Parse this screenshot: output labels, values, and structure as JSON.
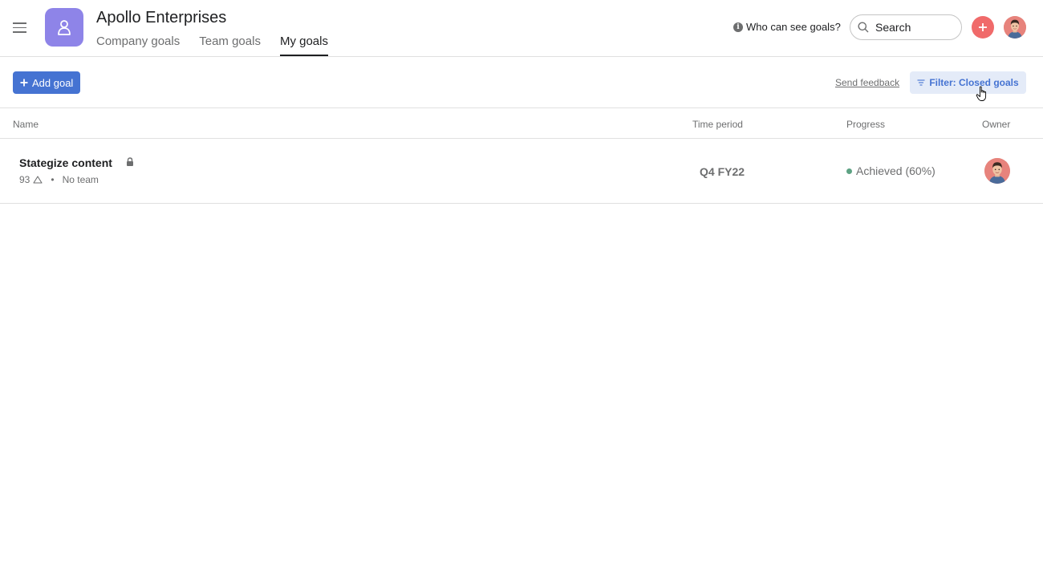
{
  "header": {
    "org_name": "Apollo Enterprises",
    "tabs": [
      {
        "label": "Company goals",
        "active": false
      },
      {
        "label": "Team goals",
        "active": false
      },
      {
        "label": "My goals",
        "active": true
      }
    ],
    "visibility_link": "Who can see goals?",
    "search_placeholder": "Search",
    "accent_color": "#f06a6a",
    "logo_color": "#8e84e8"
  },
  "toolbar": {
    "add_goal_label": "Add goal",
    "send_feedback_label": "Send feedback",
    "filter_label": "Filter: Closed goals",
    "primary_color": "#4573d2"
  },
  "table": {
    "columns": {
      "name": "Name",
      "time_period": "Time period",
      "progress": "Progress",
      "owner": "Owner"
    },
    "rows": [
      {
        "name": "Stategize content",
        "private": true,
        "likes": "93",
        "team": "No team",
        "time_period": "Q4 FY22",
        "progress_status": "Achieved (60%)",
        "status_color": "#5da283"
      }
    ]
  }
}
